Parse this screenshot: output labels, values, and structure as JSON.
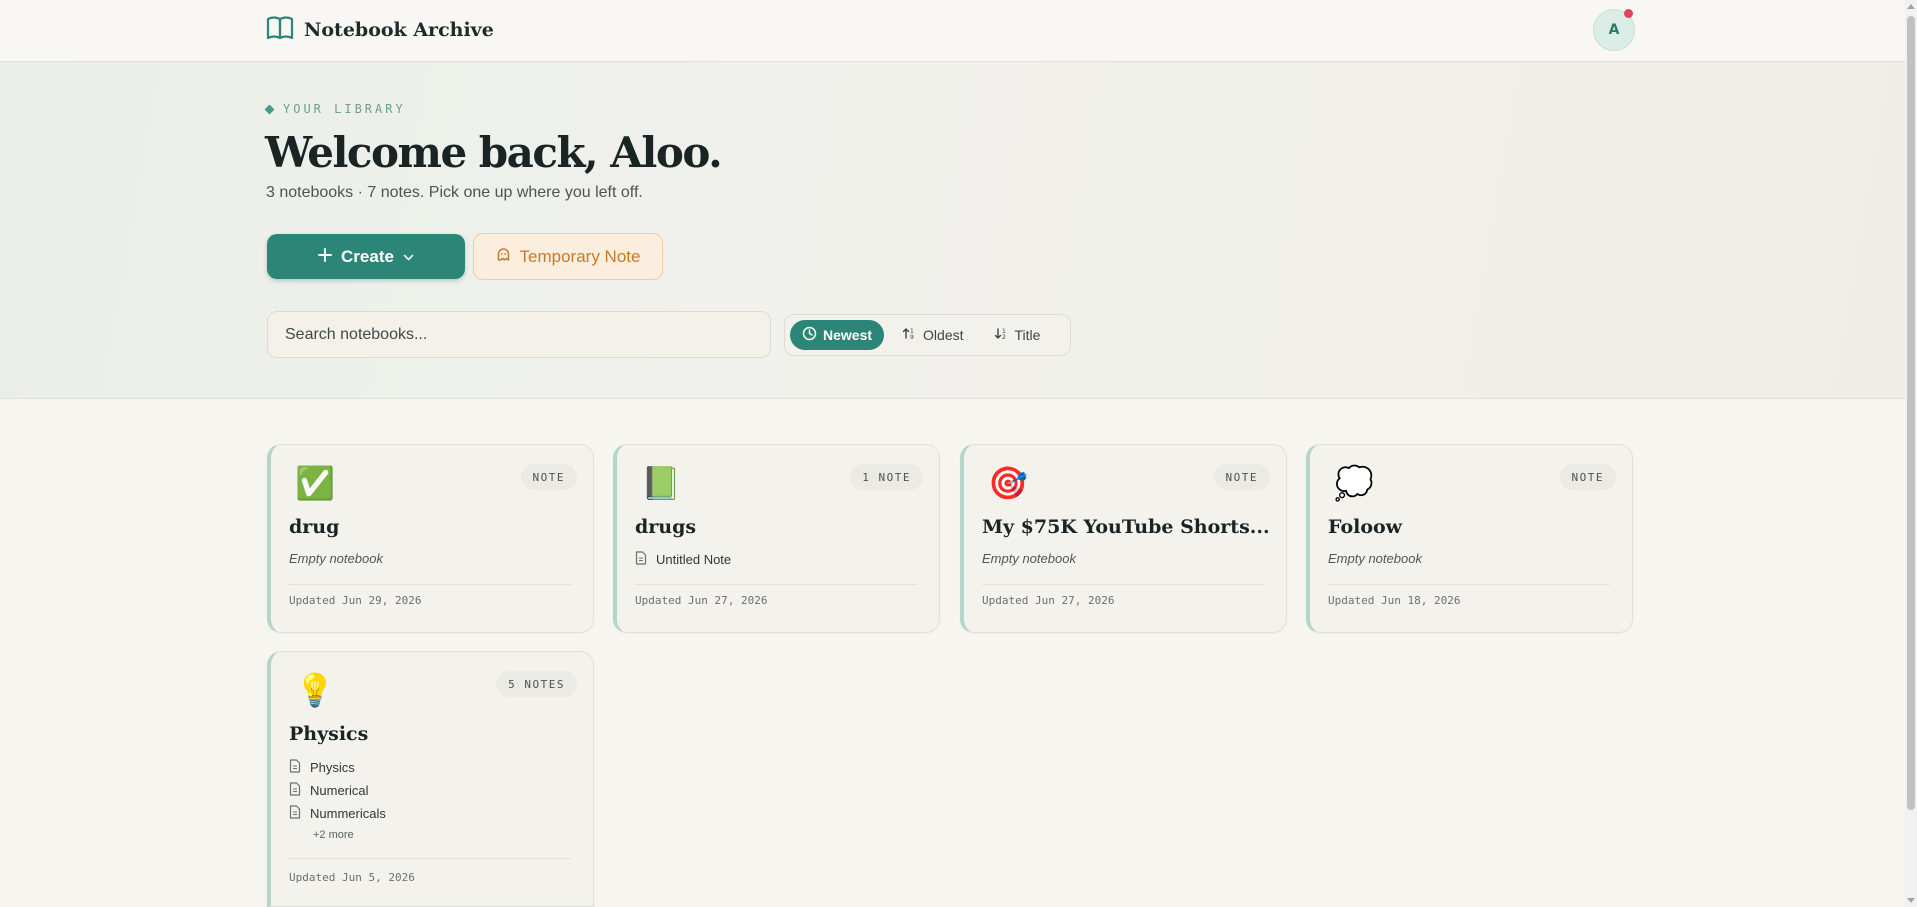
{
  "app": {
    "title": "Notebook Archive"
  },
  "user": {
    "initial": "A"
  },
  "hero": {
    "eyebrow": "YOUR LIBRARY",
    "welcome": "Welcome back, Aloo.",
    "subline": "3 notebooks · 7 notes. Pick one up where you left off."
  },
  "actions": {
    "create_label": "Create",
    "temp_label": "Temporary Note"
  },
  "search": {
    "placeholder": "Search notebooks..."
  },
  "sort": {
    "newest": "Newest",
    "oldest": "Oldest",
    "title": "Title",
    "active": "newest"
  },
  "colors": {
    "accent": "#2c8677",
    "notification": "#e0455a",
    "temp": "#c77a2a"
  },
  "notebooks": [
    {
      "emoji": "✅",
      "title": "drug",
      "badge": "NOTE",
      "empty": "Empty notebook",
      "updated": "Updated Jun 29, 2026"
    },
    {
      "emoji": "📗",
      "title": "drugs",
      "badge": "1 NOTE",
      "notes": [
        "Untitled Note"
      ],
      "updated": "Updated Jun 27, 2026"
    },
    {
      "emoji": "🎯",
      "title": "My $75K YouTube Shorts...",
      "badge": "NOTE",
      "empty": "Empty notebook",
      "updated": "Updated Jun 27, 2026"
    },
    {
      "emoji": "💭",
      "title": "Foloow",
      "badge": "NOTE",
      "empty": "Empty notebook",
      "updated": "Updated Jun 18, 2026"
    },
    {
      "emoji": "💡",
      "title": "Physics",
      "badge": "5 NOTES",
      "notes": [
        "Physics",
        "Numerical",
        "Nummericals"
      ],
      "more": "+2 more",
      "updated": "Updated Jun 5, 2026"
    }
  ]
}
